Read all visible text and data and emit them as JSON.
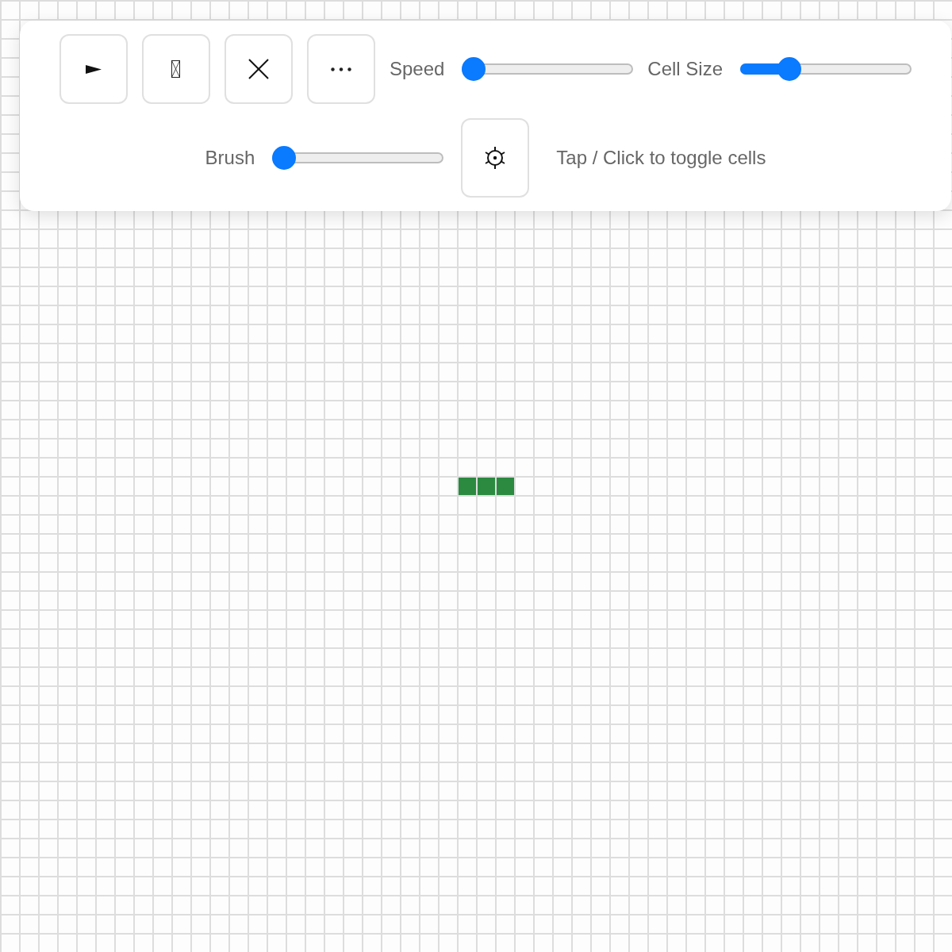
{
  "toolbar": {
    "items": [
      {
        "kind": "play"
      },
      {
        "kind": "glyph"
      },
      {
        "kind": "clear"
      },
      {
        "kind": "more"
      },
      {
        "kind": "slider",
        "label": "Speed",
        "level": 0
      },
      {
        "kind": "slider",
        "label": "Cell Size",
        "level": 0.25
      },
      {
        "kind": "slider",
        "label": "Brush",
        "level": 0
      },
      {
        "kind": "target"
      },
      {
        "kind": "hint",
        "text": "Tap / Click to toggle cells"
      }
    ]
  },
  "board": {
    "cells": [
      {
        "alive": true
      },
      {
        "alive": true
      },
      {
        "alive": true
      }
    ]
  }
}
